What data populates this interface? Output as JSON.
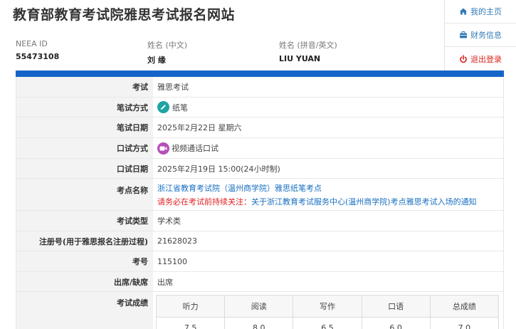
{
  "header": {
    "site_title": "教育部教育考试院雅思考试报名网站"
  },
  "user": {
    "id_label": "NEEA ID",
    "id_value": "55473108",
    "name_cn_label": "姓名 (中文)",
    "name_cn_value": "刘 缘",
    "name_en_label": "姓名 (拼音/英文)",
    "name_en_value": "LIU  YUAN"
  },
  "menu": {
    "home": "我的主页",
    "finance": "财务信息",
    "logout": "退出登录"
  },
  "details": {
    "exam_label": "考试",
    "exam_value": "雅思考试",
    "written_mode_label": "笔试方式",
    "written_mode_value": "纸笔",
    "written_date_label": "笔试日期",
    "written_date_value": "2025年2月22日 星期六",
    "oral_mode_label": "口试方式",
    "oral_mode_value": "视频通话口试",
    "oral_date_label": "口试日期",
    "oral_date_value": "2025年2月19日 15:00(24小时制)",
    "center_label": "考点名称",
    "center_value": "浙江省教育考试院（温州商学院）雅思纸笔考点",
    "notice_prefix": "请务必在考试前持续关注：",
    "notice_link": "关于浙江教育考试服务中心(温州商学院)考点雅思考试入场的通知",
    "type_label": "考试类型",
    "type_value": "学术类",
    "reg_label": "注册号(用于雅思报名注册过程)",
    "reg_value": "21628023",
    "number_label": "考号",
    "number_value": "115100",
    "attendance_label": "出席/缺席",
    "attendance_value": "出席",
    "scores_label": "考试成绩"
  },
  "scores": {
    "headers": [
      "听力",
      "阅读",
      "写作",
      "口语",
      "总成绩"
    ],
    "values": [
      "7.5",
      "8.0",
      "6.5",
      "6.0",
      "7.0"
    ]
  },
  "colors": {
    "accent_bar": "#1565c8",
    "link": "#1a6fc1",
    "logout": "#d9251d",
    "notice": "#e02020"
  }
}
